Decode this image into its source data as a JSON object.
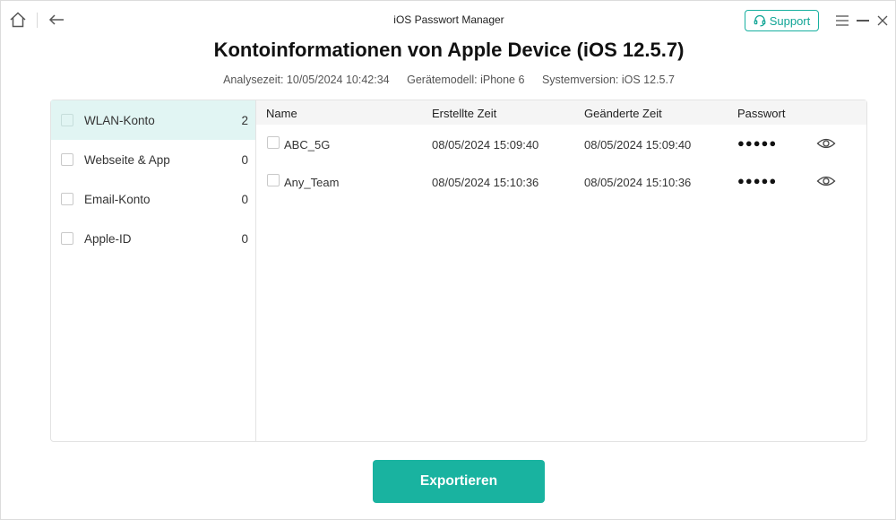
{
  "titlebar": {
    "app_title": "iOS Passwort Manager",
    "support_label": "Support"
  },
  "heading": "Kontoinformationen von Apple Device (iOS 12.5.7)",
  "meta": {
    "analysis_time": "Analysezeit: 10/05/2024 10:42:34",
    "device_model": "Gerätemodell: iPhone 6",
    "system_version": "Systemversion: iOS 12.5.7"
  },
  "sidebar": {
    "items": [
      {
        "label": "WLAN-Konto",
        "count": "2",
        "active": true
      },
      {
        "label": "Webseite & App",
        "count": "0",
        "active": false
      },
      {
        "label": "Email-Konto",
        "count": "0",
        "active": false
      },
      {
        "label": "Apple-ID",
        "count": "0",
        "active": false
      }
    ]
  },
  "table": {
    "headers": {
      "name": "Name",
      "created": "Erstellte Zeit",
      "changed": "Geänderte Zeit",
      "password": "Passwort"
    },
    "rows": [
      {
        "name": "ABC_5G",
        "created": "08/05/2024 15:09:40",
        "changed": "08/05/2024 15:09:40",
        "password": "●●●●●"
      },
      {
        "name": "Any_Team",
        "created": "08/05/2024 15:10:36",
        "changed": "08/05/2024 15:10:36",
        "password": "●●●●●"
      }
    ]
  },
  "export_label": "Exportieren",
  "colors": {
    "accent": "#19b3a0",
    "active_row": "#e1f5f3"
  },
  "icons": [
    "home-icon",
    "back-arrow-icon",
    "headset-icon",
    "menu-icon",
    "minimize-icon",
    "close-icon",
    "eye-icon"
  ]
}
